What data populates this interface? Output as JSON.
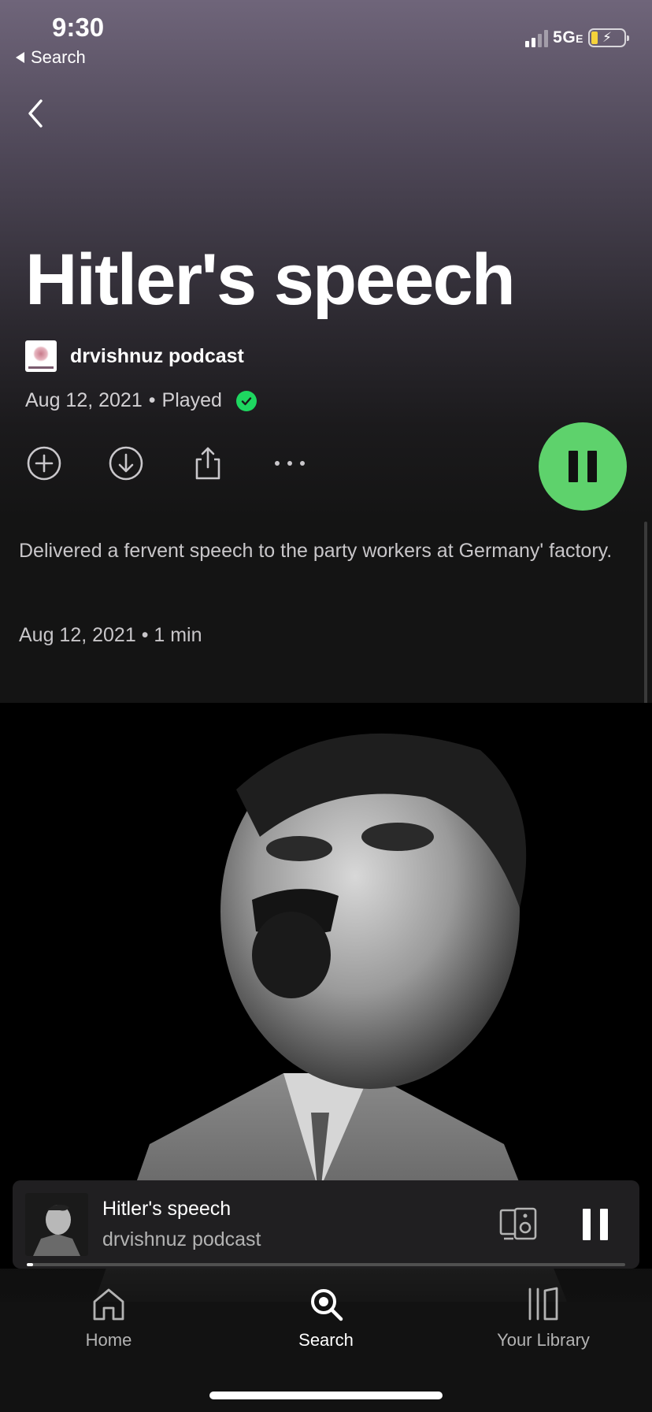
{
  "status_bar": {
    "time": "9:30",
    "back_app_label": "Search",
    "network": "5G",
    "network_suffix": "E",
    "battery_charging": true
  },
  "episode": {
    "title": "Hitler's speech",
    "show_name": "drvishnuz podcast",
    "date": "Aug 12, 2021",
    "played_label": "Played",
    "description": "Delivered a fervent speech to the party workers at Germany' factory.",
    "meta": "Aug 12, 2021 • 1 min"
  },
  "actions": {
    "icons": [
      "add-circle-icon",
      "download-icon",
      "share-icon",
      "more-icon"
    ],
    "play_state": "playing"
  },
  "mini_player": {
    "title": "Hitler's speech",
    "subtitle": "drvishnuz podcast",
    "progress": 0.01
  },
  "tabs": [
    {
      "label": "Home",
      "icon": "home-icon",
      "active": false
    },
    {
      "label": "Search",
      "icon": "search-icon",
      "active": true
    },
    {
      "label": "Your Library",
      "icon": "library-icon",
      "active": false
    }
  ],
  "colors": {
    "accent_green": "#5ed26c",
    "check_green": "#1ed760",
    "background": "#121212"
  }
}
